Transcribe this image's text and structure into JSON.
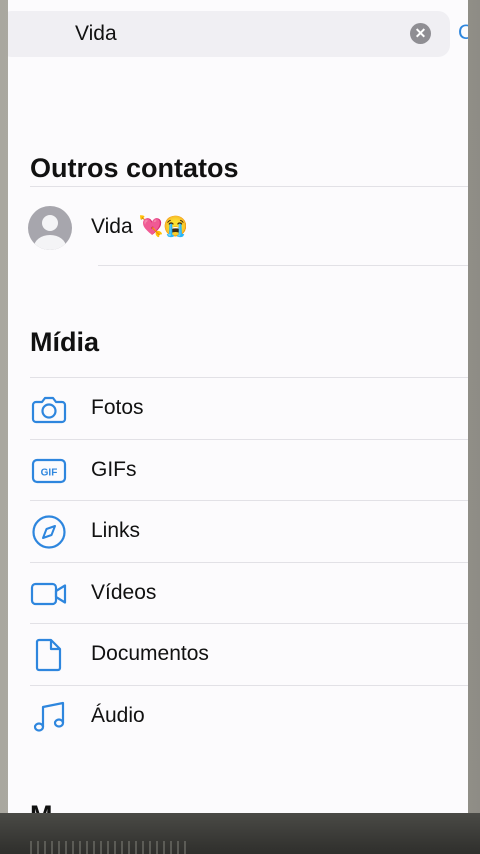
{
  "search": {
    "query": "Vida",
    "clear_label": "✕",
    "cancel_peek": "C"
  },
  "contacts_section": {
    "title": "Outros contatos",
    "contacts": [
      {
        "name": "Vida",
        "emojis": "💘😭"
      }
    ]
  },
  "media_section": {
    "title": "Mídia",
    "items": [
      {
        "label": "Fotos",
        "icon": "camera-icon"
      },
      {
        "label": "GIFs",
        "icon": "gif-icon",
        "icon_text": "GIF"
      },
      {
        "label": "Links",
        "icon": "compass-icon"
      },
      {
        "label": "Vídeos",
        "icon": "video-icon"
      },
      {
        "label": "Documentos",
        "icon": "document-icon"
      },
      {
        "label": "Áudio",
        "icon": "music-note-icon"
      }
    ]
  },
  "next_section_peek": "M",
  "colors": {
    "accent": "#2e86de",
    "text": "#111111",
    "divider": "#e2e1e6"
  }
}
